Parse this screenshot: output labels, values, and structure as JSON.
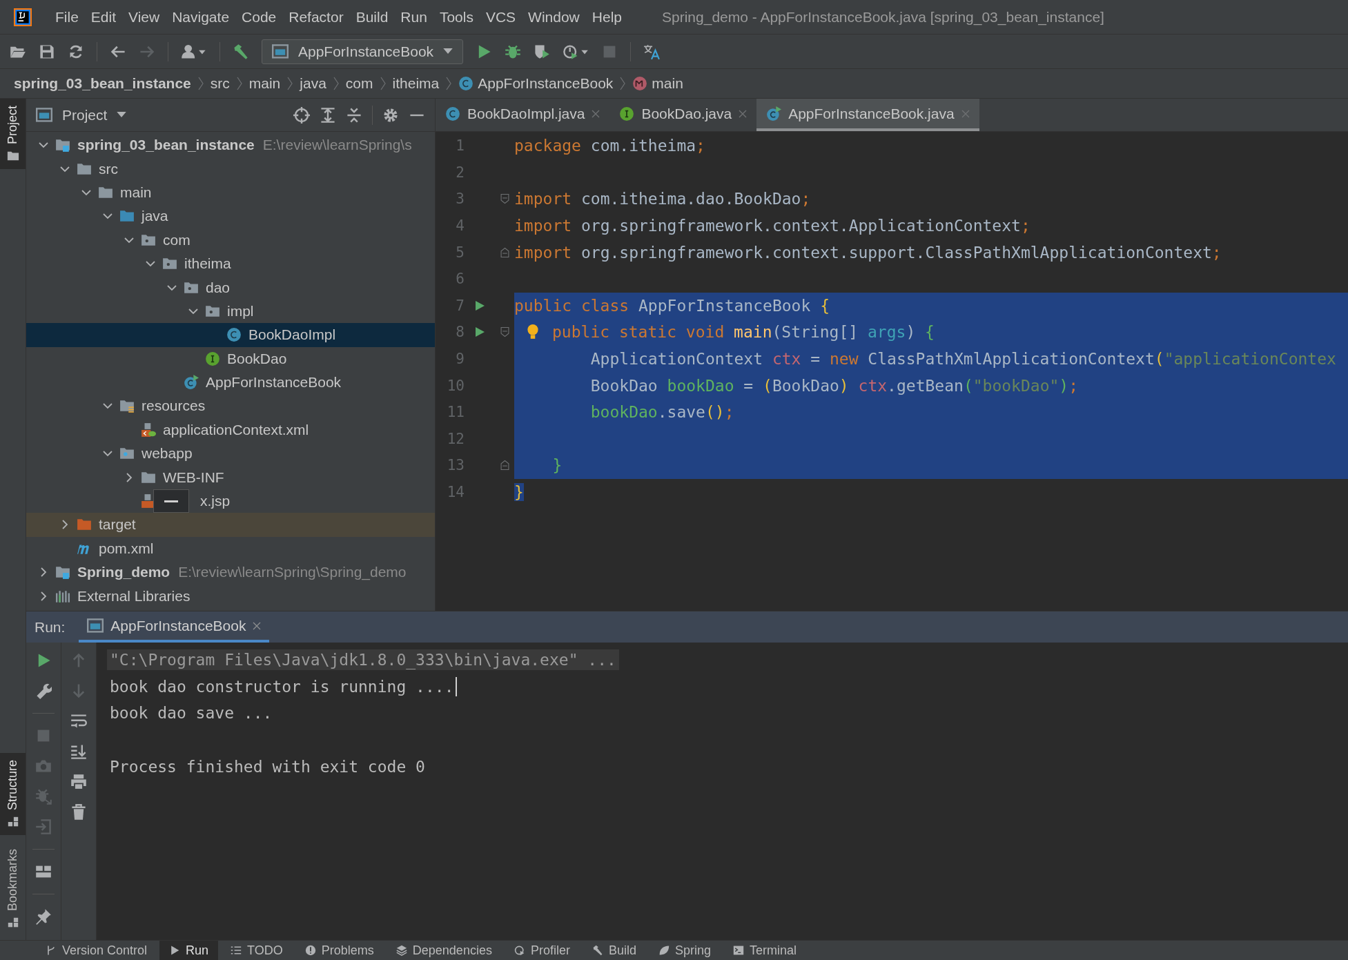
{
  "menu_bar": {
    "items": [
      "File",
      "Edit",
      "View",
      "Navigate",
      "Code",
      "Refactor",
      "Build",
      "Run",
      "Tools",
      "VCS",
      "Window",
      "Help"
    ],
    "title": "Spring_demo - AppForInstanceBook.java [spring_03_bean_instance]"
  },
  "toolbar": {
    "items": [
      {
        "kind": "open",
        "disabled": false
      },
      {
        "kind": "save",
        "disabled": false
      },
      {
        "kind": "sync",
        "disabled": false
      },
      {
        "kind": "sep"
      },
      {
        "kind": "back",
        "disabled": false
      },
      {
        "kind": "forward",
        "disabled": true
      },
      {
        "kind": "sep"
      },
      {
        "kind": "user",
        "disabled": false
      },
      {
        "kind": "sep"
      },
      {
        "kind": "build",
        "disabled": false
      },
      {
        "kind": "config",
        "label": "AppForInstanceBook"
      },
      {
        "kind": "run",
        "disabled": false
      },
      {
        "kind": "debug",
        "disabled": false
      },
      {
        "kind": "coverage",
        "disabled": false
      },
      {
        "kind": "profile",
        "disabled": false
      },
      {
        "kind": "stop",
        "disabled": true
      },
      {
        "kind": "sep"
      },
      {
        "kind": "translate",
        "disabled": false
      }
    ]
  },
  "breadcrumb": [
    {
      "label": "spring_03_bean_instance",
      "kind": "module"
    },
    {
      "label": "src",
      "kind": "folder"
    },
    {
      "label": "main",
      "kind": "folder"
    },
    {
      "label": "java",
      "kind": "folder"
    },
    {
      "label": "com",
      "kind": "folder"
    },
    {
      "label": "itheima",
      "kind": "folder"
    },
    {
      "label": "AppForInstanceBook",
      "kind": "class"
    },
    {
      "label": "main",
      "kind": "method"
    }
  ],
  "tool_stripe": [
    {
      "label": "Project",
      "selected": true
    },
    {
      "label": "Structure",
      "selected": true
    },
    {
      "label": "Bookmarks",
      "selected": false
    }
  ],
  "project_panel": {
    "title": "Project",
    "tree": [
      {
        "label": "spring_03_bean_instance",
        "kind": "module",
        "path": "E:\\review\\learnSpring\\s",
        "expanded": true,
        "selected": false,
        "highlighted": false,
        "children": [
          {
            "label": "src",
            "kind": "folder",
            "expanded": true,
            "selected": false,
            "highlighted": false,
            "children": [
              {
                "label": "main",
                "kind": "folder",
                "expanded": true,
                "selected": false,
                "highlighted": false,
                "children": [
                  {
                    "label": "java",
                    "kind": "source",
                    "expanded": true,
                    "selected": false,
                    "highlighted": false,
                    "children": [
                      {
                        "label": "com",
                        "kind": "package",
                        "expanded": true,
                        "selected": false,
                        "highlighted": false,
                        "children": [
                          {
                            "label": "itheima",
                            "kind": "package",
                            "expanded": true,
                            "selected": false,
                            "highlighted": false,
                            "children": [
                              {
                                "label": "dao",
                                "kind": "package",
                                "expanded": true,
                                "selected": false,
                                "highlighted": false,
                                "children": [
                                  {
                                    "label": "impl",
                                    "kind": "package",
                                    "expanded": true,
                                    "selected": false,
                                    "highlighted": false,
                                    "children": [
                                      {
                                        "label": "BookDaoImpl",
                                        "kind": "class",
                                        "selected": true,
                                        "highlighted": false
                                      }
                                    ]
                                  },
                                  {
                                    "label": "BookDao",
                                    "kind": "interface",
                                    "selected": false,
                                    "highlighted": false
                                  }
                                ]
                              },
                              {
                                "label": "AppForInstanceBook",
                                "kind": "class-run",
                                "selected": false,
                                "highlighted": false
                              }
                            ]
                          }
                        ]
                      }
                    ]
                  },
                  {
                    "label": "resources",
                    "kind": "resources",
                    "expanded": true,
                    "selected": false,
                    "highlighted": false,
                    "children": [
                      {
                        "label": "applicationContext.xml",
                        "kind": "xml",
                        "selected": false,
                        "highlighted": false
                      }
                    ]
                  },
                  {
                    "label": "webapp",
                    "kind": "web",
                    "expanded": true,
                    "selected": false,
                    "highlighted": false,
                    "children": [
                      {
                        "label": "WEB-INF",
                        "kind": "folder",
                        "expanded": false,
                        "popup": false,
                        "selected": false,
                        "highlighted": false
                      },
                      {
                        "label": "x.jsp",
                        "kind": "jsp",
                        "popup": true,
                        "selected": false,
                        "highlighted": false
                      }
                    ]
                  }
                ]
              }
            ]
          },
          {
            "label": "target",
            "kind": "excluded",
            "expanded": false,
            "selected": false,
            "highlighted": true
          },
          {
            "label": "pom.xml",
            "kind": "maven",
            "selected": false,
            "highlighted": false
          }
        ]
      },
      {
        "label": "Spring_demo",
        "kind": "module",
        "path": "E:\\review\\learnSpring\\Spring_demo",
        "expanded": false,
        "selected": false,
        "highlighted": false
      },
      {
        "label": "External Libraries",
        "kind": "libraries",
        "expanded": false,
        "selected": false,
        "highlighted": false
      }
    ]
  },
  "editor_tabs": [
    {
      "label": "BookDaoImpl.java",
      "kind": "class",
      "selected": false
    },
    {
      "label": "BookDao.java",
      "kind": "interface",
      "selected": false
    },
    {
      "label": "AppForInstanceBook.java",
      "kind": "class-run",
      "selected": true
    }
  ],
  "editor": {
    "lines": [
      {
        "number": "1",
        "selected": false,
        "run_marker": false,
        "bulb": false,
        "fold_start": false,
        "fold_end": false,
        "tokens": [
          {
            "text": "package",
            "kind": "kw"
          },
          {
            "text": " com.itheima",
            "kind": "plain"
          },
          {
            "text": ";",
            "kind": "kw"
          }
        ]
      },
      {
        "number": "2",
        "selected": false,
        "run_marker": false,
        "bulb": false,
        "fold_start": false,
        "fold_end": false
      },
      {
        "number": "3",
        "selected": false,
        "run_marker": false,
        "bulb": false,
        "fold_start": true,
        "fold_end": false,
        "tokens": [
          {
            "text": "import",
            "kind": "kw"
          },
          {
            "text": " com.itheima.dao.BookDao",
            "kind": "plain"
          },
          {
            "text": ";",
            "kind": "kw"
          }
        ]
      },
      {
        "number": "4",
        "selected": false,
        "run_marker": false,
        "bulb": false,
        "fold_start": false,
        "fold_end": false,
        "tokens": [
          {
            "text": "import",
            "kind": "kw"
          },
          {
            "text": " org.springframework.context.ApplicationContext",
            "kind": "plain"
          },
          {
            "text": ";",
            "kind": "kw"
          }
        ]
      },
      {
        "number": "5",
        "selected": false,
        "run_marker": false,
        "bulb": false,
        "fold_start": false,
        "fold_end": true,
        "tokens": [
          {
            "text": "import",
            "kind": "kw"
          },
          {
            "text": " org.springframework.context.support.ClassPathXmlApplicationContext",
            "kind": "plain"
          },
          {
            "text": ";",
            "kind": "kw"
          }
        ]
      },
      {
        "number": "6",
        "selected": false,
        "run_marker": false,
        "bulb": false,
        "fold_start": false,
        "fold_end": false
      },
      {
        "number": "7",
        "selected": true,
        "run_marker": true,
        "bulb": false,
        "fold_start": false,
        "fold_end": false,
        "tokens": [
          {
            "text": "public class",
            "kind": "kw"
          },
          {
            "text": " AppForInstanceBook ",
            "kind": "plain"
          },
          {
            "text": "{",
            "kind": "brace1"
          }
        ]
      },
      {
        "number": "8",
        "selected": true,
        "run_marker": true,
        "bulb": true,
        "fold_start": true,
        "fold_end": false,
        "tokens": [
          {
            "text": "public static void",
            "kind": "kw"
          },
          {
            "text": " main",
            "kind": "method"
          },
          {
            "text": "(String[] ",
            "kind": "plain"
          },
          {
            "text": "args",
            "kind": "param"
          },
          {
            "text": ") ",
            "kind": "plain"
          },
          {
            "text": "{",
            "kind": "brace2"
          }
        ]
      },
      {
        "number": "9",
        "selected": true,
        "run_marker": false,
        "bulb": false,
        "fold_start": false,
        "fold_end": false,
        "tokens": [
          {
            "text": "        ApplicationContext ",
            "kind": "plain"
          },
          {
            "text": "ctx",
            "kind": "field"
          },
          {
            "text": " = ",
            "kind": "plain"
          },
          {
            "text": "new",
            "kind": "kw"
          },
          {
            "text": " ClassPathXmlApplicationContext",
            "kind": "plain"
          },
          {
            "text": "(",
            "kind": "brace1"
          },
          {
            "text": "\"applicationContex",
            "kind": "string"
          }
        ]
      },
      {
        "number": "10",
        "selected": true,
        "run_marker": false,
        "bulb": false,
        "fold_start": false,
        "fold_end": false,
        "tokens": [
          {
            "text": "        BookDao ",
            "kind": "plain"
          },
          {
            "text": "bookDao",
            "kind": "local"
          },
          {
            "text": " = ",
            "kind": "plain"
          },
          {
            "text": "(",
            "kind": "brace1"
          },
          {
            "text": "BookDao",
            "kind": "plain"
          },
          {
            "text": ") ",
            "kind": "brace1"
          },
          {
            "text": "ctx",
            "kind": "field"
          },
          {
            "text": ".getBean",
            "kind": "plain"
          },
          {
            "text": "(",
            "kind": "brace2"
          },
          {
            "text": "\"bookDao\"",
            "kind": "string"
          },
          {
            "text": ")",
            "kind": "brace2"
          },
          {
            "text": ";",
            "kind": "kw"
          }
        ]
      },
      {
        "number": "11",
        "selected": true,
        "run_marker": false,
        "bulb": false,
        "fold_start": false,
        "fold_end": false,
        "tokens": [
          {
            "text": "        bookDao",
            "kind": "local"
          },
          {
            "text": ".save",
            "kind": "plain"
          },
          {
            "text": "()",
            "kind": "brace1"
          },
          {
            "text": ";",
            "kind": "kw"
          }
        ]
      },
      {
        "number": "12",
        "selected": true,
        "run_marker": false,
        "bulb": false,
        "fold_start": false,
        "fold_end": false
      },
      {
        "number": "13",
        "selected": true,
        "run_marker": false,
        "bulb": false,
        "fold_start": false,
        "fold_end": true,
        "tokens": [
          {
            "text": "    }",
            "kind": "brace2"
          }
        ]
      },
      {
        "number": "14",
        "selected": false,
        "run_marker": false,
        "bulb": false,
        "fold_start": false,
        "fold_end": false,
        "tokens": [
          {
            "text": "}",
            "kind": "brace1",
            "selected": true
          }
        ]
      }
    ]
  },
  "run_panel": {
    "label": "Run:",
    "tab": {
      "label": "AppForInstanceBook",
      "selected": true
    },
    "left_tools": [
      {
        "kind": "run",
        "disabled": false
      },
      {
        "kind": "wrench",
        "disabled": false
      },
      {
        "kind": "sep"
      },
      {
        "kind": "stop",
        "disabled": true
      },
      {
        "kind": "camera",
        "disabled": true
      },
      {
        "kind": "bug",
        "disabled": true
      },
      {
        "kind": "exit",
        "disabled": true
      },
      {
        "kind": "sep"
      },
      {
        "kind": "layout",
        "disabled": false
      },
      {
        "kind": "sep"
      },
      {
        "kind": "pin",
        "disabled": false
      }
    ],
    "right_tools": [
      {
        "kind": "up",
        "disabled": true
      },
      {
        "kind": "down",
        "disabled": true
      },
      {
        "kind": "wrap",
        "disabled": false
      },
      {
        "kind": "scroll",
        "disabled": false
      },
      {
        "kind": "print",
        "disabled": false
      },
      {
        "kind": "trash",
        "disabled": false
      }
    ],
    "console": [
      {
        "text": "\"C:\\Program Files\\Java\\jdk1.8.0_333\\bin\\java.exe\" ...",
        "kind": "command",
        "caret": false
      },
      {
        "text": "book dao constructor is running ....",
        "kind": "output",
        "caret": true
      },
      {
        "text": "book dao save ...",
        "kind": "output",
        "caret": false
      },
      {
        "text": "Process finished with exit code 0",
        "kind": "status",
        "caret": false
      }
    ]
  },
  "bottom_tabs": [
    {
      "label": "Version Control",
      "kind": "vcs",
      "selected": false
    },
    {
      "label": "Run",
      "kind": "run",
      "selected": true
    },
    {
      "label": "TODO",
      "kind": "list",
      "selected": false
    },
    {
      "label": "Problems",
      "kind": "problems",
      "selected": false
    },
    {
      "label": "Dependencies",
      "kind": "layers",
      "selected": false
    },
    {
      "label": "Profiler",
      "kind": "profile",
      "selected": false
    },
    {
      "label": "Build",
      "kind": "build",
      "selected": false
    },
    {
      "label": "Spring",
      "kind": "leaf",
      "selected": false
    },
    {
      "label": "Terminal",
      "kind": "terminal",
      "selected": false
    }
  ]
}
